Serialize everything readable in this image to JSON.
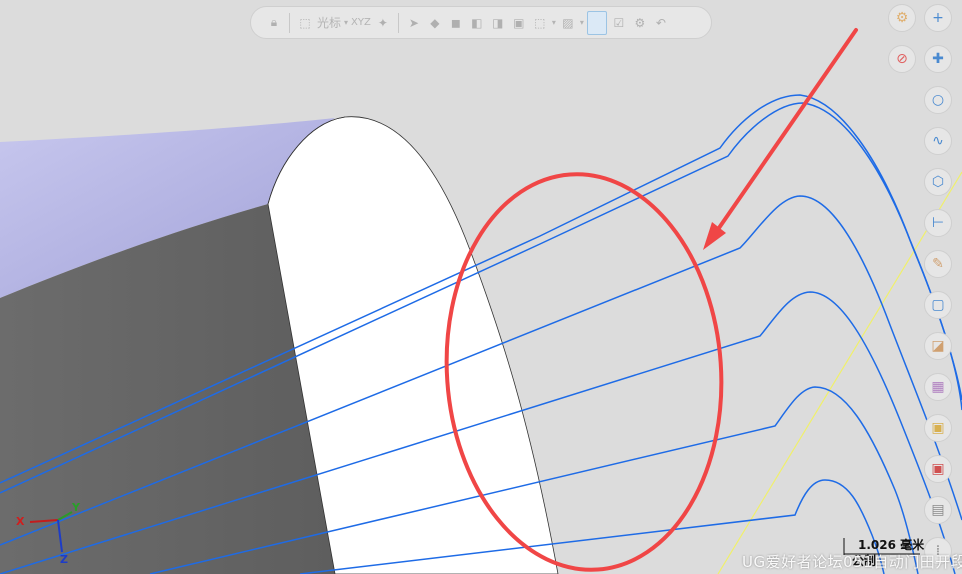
{
  "toolbar": {
    "cursor_label": "光标",
    "xyz_label": "XYZ"
  },
  "triad": {
    "x_label": "X",
    "y_label": "Y",
    "z_label": "Z"
  },
  "scale": {
    "value_label": "1.026 毫米",
    "unit_label": "公制"
  },
  "watermark": {
    "text": "UG爱好者论坛051自动门田开段"
  },
  "colors": {
    "background": "#dcdcdc",
    "toolpath": "#1e6be6",
    "annotation": "#f04646",
    "arrow": "#f04646",
    "guide_line": "#f0f06a",
    "solid_face_lit": "#ffffff",
    "solid_face_dark": "#666666",
    "solid_face_top": "#b4b4e8"
  },
  "icons": {
    "right_tools_col1": [
      "gear-icon",
      "no-entry-icon"
    ],
    "right_tools_col2": [
      "plus-icon",
      "sparkle-plus-icon",
      "circle-icon",
      "curve-icon",
      "cube-icon",
      "dimension-icon",
      "pencil-icon",
      "box-icon",
      "shaded-box-icon",
      "color-swatch-icon",
      "yellow-swatch-icon",
      "red-swatch-icon",
      "grid-icon",
      "dots-grid-icon",
      "wrench-icon"
    ]
  }
}
